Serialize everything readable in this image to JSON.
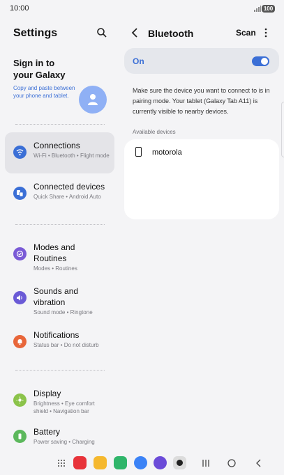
{
  "status_bar": {
    "time": "10:00",
    "battery": "100"
  },
  "settings": {
    "title": "Settings",
    "sign_in": {
      "heading": "Sign in to your Galaxy",
      "subtext": "Copy and paste between your phone and tablet."
    },
    "items": [
      {
        "label": "Connections",
        "sub": "Wi-Fi • Bluetooth • Flight mode",
        "icon": "wifi-icon",
        "color": "#3b6fd6"
      },
      {
        "label": "Connected devices",
        "sub": "Quick Share • Android Auto",
        "icon": "connected-devices-icon",
        "color": "#3b6fd6"
      },
      {
        "label": "Modes and Routines",
        "sub": "Modes • Routines",
        "icon": "modes-icon",
        "color": "#7a5ad6"
      },
      {
        "label": "Sounds and vibration",
        "sub": "Sound mode • Ringtone",
        "icon": "sound-icon",
        "color": "#6a5ad6"
      },
      {
        "label": "Notifications",
        "sub": "Status bar • Do not disturb",
        "icon": "bell-icon",
        "color": "#e8663a"
      },
      {
        "label": "Display",
        "sub": "Brightness • Eye comfort shield • Navigation bar",
        "icon": "sun-icon",
        "color": "#8bc34a"
      },
      {
        "label": "Battery",
        "sub": "Power saving • Charging",
        "icon": "battery-icon",
        "color": "#5cb85c"
      }
    ]
  },
  "bluetooth": {
    "title": "Bluetooth",
    "scan_label": "Scan",
    "toggle_label": "On",
    "info": "Make sure the device you want to connect to is in pairing mode. Your tablet (Galaxy Tab A11) is currently visible to nearby devices.",
    "available_header": "Available devices",
    "devices": [
      {
        "name": "motorola",
        "icon": "phone-icon"
      }
    ]
  },
  "dock": {
    "apps": [
      {
        "name": "app-red-icon",
        "color": "#e8333a"
      },
      {
        "name": "app-folder-icon",
        "color": "#f5b82e"
      },
      {
        "name": "app-phone-icon",
        "color": "#2fb56a"
      },
      {
        "name": "app-messages-icon",
        "color": "#3b82f6"
      },
      {
        "name": "app-browser-icon",
        "color": "#6b4bd8"
      },
      {
        "name": "app-camera-icon",
        "color": "#dcdcdc"
      }
    ]
  }
}
